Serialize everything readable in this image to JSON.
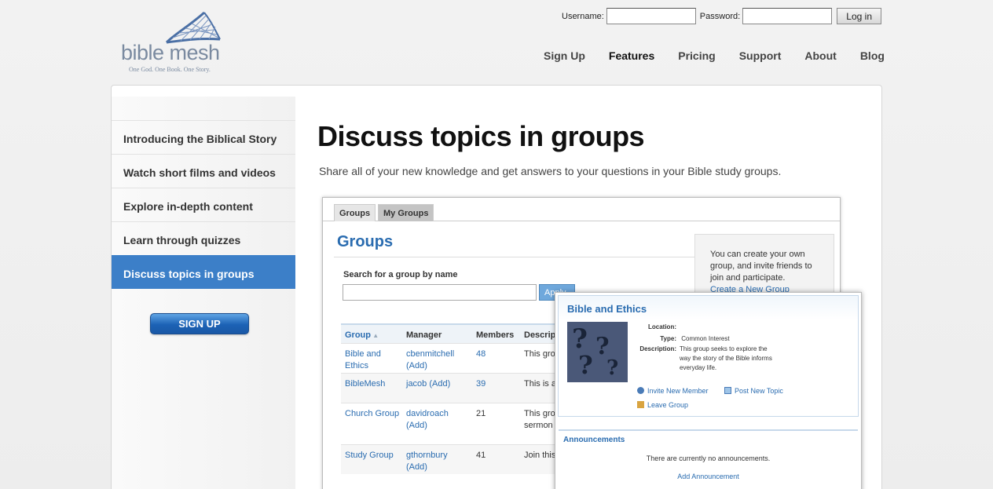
{
  "brand": {
    "name": "bible mesh",
    "tagline": "One God. One Book. One Story."
  },
  "login": {
    "username_label": "Username:",
    "password_label": "Password:",
    "button": "Log in"
  },
  "nav": {
    "items": [
      {
        "label": "Sign Up",
        "active": false
      },
      {
        "label": "Features",
        "active": true
      },
      {
        "label": "Pricing",
        "active": false
      },
      {
        "label": "Support",
        "active": false
      },
      {
        "label": "About",
        "active": false
      },
      {
        "label": "Blog",
        "active": false
      }
    ]
  },
  "sidebar": {
    "items": [
      {
        "label": "Introducing the Biblical Story",
        "active": false
      },
      {
        "label": "Watch short films and videos",
        "active": false
      },
      {
        "label": "Explore in-depth content",
        "active": false
      },
      {
        "label": "Learn through quizzes",
        "active": false
      },
      {
        "label": "Discuss topics in groups",
        "active": true
      }
    ],
    "signup_button": "SIGN UP"
  },
  "main": {
    "heading": "Discuss topics in groups",
    "subheading": "Share all of your new knowledge and get answers to your questions in your Bible study groups."
  },
  "screenshot": {
    "tabs": [
      "Groups",
      "My Groups"
    ],
    "title": "Groups",
    "search_label": "Search for a group by name",
    "apply_button": "Apply",
    "columns": [
      "Group",
      "Manager",
      "Members",
      "Descript"
    ],
    "rows": [
      {
        "group": "Bible and Ethics",
        "manager": "cbenmitchell (Add)",
        "members": "48",
        "desc": "This grou"
      },
      {
        "group": "BibleMesh",
        "manager": "jacob (Add)",
        "members": "39",
        "desc": "This is a"
      },
      {
        "group": "Church Group",
        "manager": "davidroach (Add)",
        "members": "21",
        "desc": "This grou sermon s"
      },
      {
        "group": "Study Group",
        "manager": "gthornbury (Add)",
        "members": "41",
        "desc": "Join this"
      }
    ],
    "info_text": "You can create your own group, and invite friends to join and participate.",
    "info_link": "Create a New Group"
  },
  "popup": {
    "title": "Bible and Ethics",
    "location_label": "Location:",
    "location_value": "",
    "type_label": "Type:",
    "type_value": "Common Interest",
    "description_label": "Description:",
    "description_value": "This group seeks to explore the way the story of the Bible informs everyday life.",
    "invite": "Invite New Member",
    "post": "Post New Topic",
    "leave": "Leave Group",
    "announcements_title": "Announcements",
    "no_announcements": "There are currently no announcements.",
    "add_announcement": "Add Announcement"
  }
}
